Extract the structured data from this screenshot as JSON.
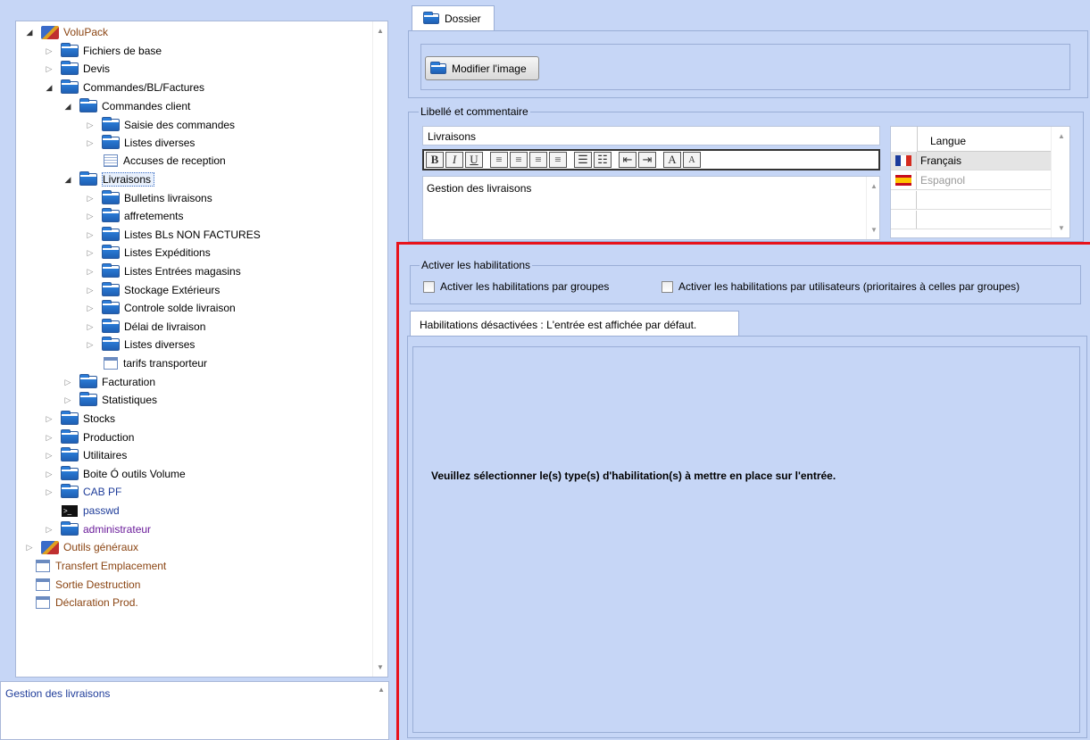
{
  "tree": {
    "nodes": [
      {
        "label": "VoluPack"
      },
      {
        "label": "Fichiers de base"
      },
      {
        "label": "Devis"
      },
      {
        "label": "Commandes/BL/Factures"
      },
      {
        "label": "Commandes client"
      },
      {
        "label": "Saisie des commandes"
      },
      {
        "label": "Listes diverses"
      },
      {
        "label": "Accuses de reception"
      },
      {
        "label": "Livraisons"
      },
      {
        "label": "Bulletins livraisons"
      },
      {
        "label": "affretements"
      },
      {
        "label": "Listes BLs NON FACTURES"
      },
      {
        "label": "Listes Expéditions"
      },
      {
        "label": "Listes Entrées magasins"
      },
      {
        "label": "Stockage Extérieurs"
      },
      {
        "label": "Controle solde livraison"
      },
      {
        "label": "Délai de livraison"
      },
      {
        "label": "Listes diverses"
      },
      {
        "label": "tarifs transporteur"
      },
      {
        "label": "Facturation"
      },
      {
        "label": "Statistiques"
      },
      {
        "label": "Stocks"
      },
      {
        "label": "Production"
      },
      {
        "label": "Utilitaires"
      },
      {
        "label": "Boite Ó outils Volume"
      },
      {
        "label": "CAB PF"
      },
      {
        "label": "passwd"
      },
      {
        "label": "administrateur"
      },
      {
        "label": "Outils généraux"
      },
      {
        "label": "Transfert Emplacement"
      },
      {
        "label": "Sortie Destruction"
      },
      {
        "label": "Déclaration Prod."
      }
    ]
  },
  "description": "Gestion des livraisons",
  "dossier": {
    "tab_label": "Dossier",
    "button_label": "Modifier l'image"
  },
  "libelle": {
    "legend": "Libellé et commentaire",
    "value": "Livraisons",
    "comment": "Gestion des livraisons",
    "toolbar": [
      "B",
      "I",
      "U",
      "≡",
      "≡",
      "≡",
      "≡",
      "☰",
      "☷",
      "⇤",
      "⇥",
      "A",
      "A"
    ]
  },
  "languages": {
    "header": "Langue",
    "rows": [
      {
        "name": "Français",
        "active": true
      },
      {
        "name": "Espagnol",
        "active": false
      }
    ]
  },
  "habilitations": {
    "legend": "Activer les habilitations",
    "by_groups": "Activer les habilitations par groupes",
    "by_users": "Activer les habilitations par utilisateurs (prioritaires à celles par groupes)",
    "tab_label": "Habilitations désactivées : L'entrée est affichée par défaut.",
    "message": "Veuillez sélectionner le(s) type(s) d'habilitation(s) à mettre en place sur l'entrée."
  },
  "colors": {
    "background": "#c6d6f6",
    "highlight": "#e8131b",
    "link_brown": "#8b4513",
    "link_blue": "#1f3d9a"
  }
}
